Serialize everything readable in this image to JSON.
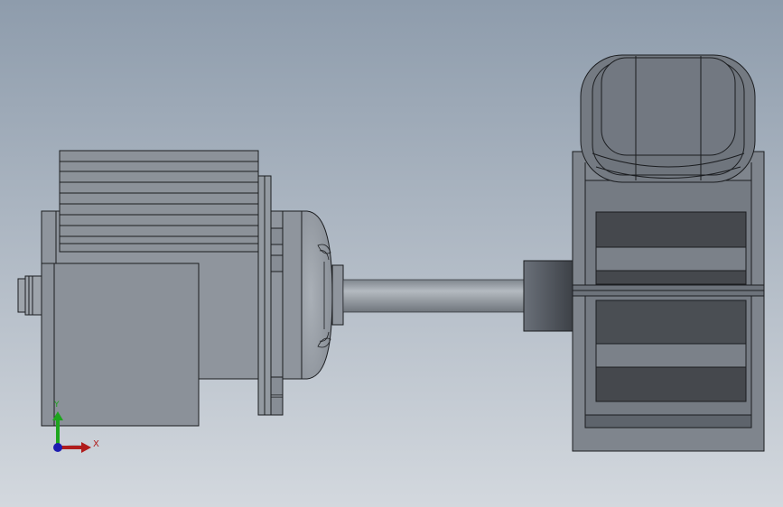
{
  "viewport": {
    "background_top": "#8e9cac",
    "background_bottom": "#d3d8de"
  },
  "triad": {
    "x_label": "X",
    "y_label": "Y",
    "x_color": "#b01c1c",
    "y_color": "#1ea51e",
    "z_color": "#1c1cb0"
  },
  "model": {
    "body_color": "#8f959d",
    "dark_color": "#45484d",
    "edge_color": "#1b1d20"
  }
}
